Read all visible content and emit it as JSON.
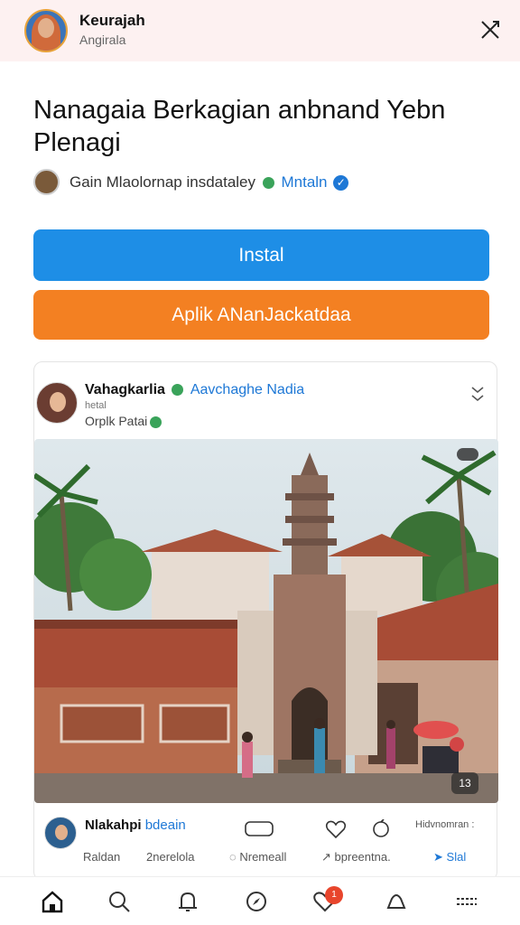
{
  "header": {
    "profile_name": "Keurajah",
    "profile_sub": "Angirala",
    "close_icon": "close-icon"
  },
  "headline": "Nanagaia Berkagian anbnand Yebn Plenagi",
  "source": {
    "text": "Gain Mlaolornap insdataley",
    "link": "Mntaln",
    "verified_icon": "verified-icon"
  },
  "buttons": {
    "install": "Instal",
    "open": "Aplik ANanJackatdaa"
  },
  "post": {
    "author": "Vahagkarlia",
    "tag": "Aavchaghe Nadia",
    "meta": "hetal",
    "desc": "Orplk Patai",
    "photo_badge": "13",
    "colors": {
      "accent_blue": "#1e8ee6",
      "accent_orange": "#f38022"
    }
  },
  "comment": {
    "name": "Nlakahpi",
    "tag": "bdeain",
    "more_text": "Hidvnomran :",
    "stats": [
      {
        "label": "Raldan",
        "kind": "plain"
      },
      {
        "label": "2nerelola",
        "kind": "plain"
      },
      {
        "label": "Nremeall",
        "kind": "icon"
      },
      {
        "label": "bpreentna.",
        "kind": "icon"
      },
      {
        "label": "Slal",
        "kind": "share"
      }
    ]
  },
  "tabbar": {
    "items": [
      "home-icon",
      "search-icon",
      "bell-icon",
      "compass-icon",
      "heart-icon",
      "notification-icon",
      "menu-icon"
    ],
    "badge": "1"
  }
}
